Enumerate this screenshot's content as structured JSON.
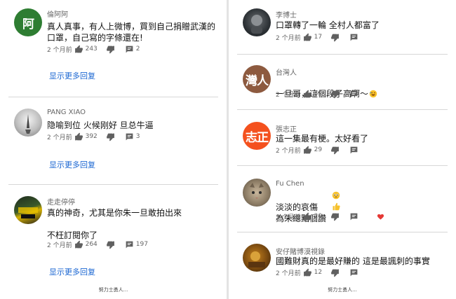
{
  "left": {
    "comments": [
      {
        "author": "倫阿阿",
        "avatar_text": "阿",
        "avatar_color": "#2e7d32",
        "body": "真人真事，有人上微博，買到自己捐贈武漢的\n口罩，自己寫的字條還在!",
        "time": "2 个月前",
        "likes": "243",
        "replies": "2"
      },
      {
        "author": "PANG XIAO",
        "avatar_text": "",
        "body": "隐喻到位 火候刚好 旦总牛逼",
        "time": "2 个月前",
        "likes": "392",
        "replies": "3"
      },
      {
        "author": "走走停停",
        "avatar_text": "",
        "body": "真的神奇，尤其是你朱一旦敢拍出來\n\n不枉訂閱你了",
        "time": "2 个月前",
        "likes": "264",
        "replies": "197"
      }
    ],
    "show_more": [
      "显示更多回复",
      "显示更多回复",
      "显示更多回复"
    ],
    "footer": "努力士勇人..."
  },
  "right": {
    "comments": [
      {
        "author": "李博士",
        "avatar_text": "",
        "body": "口罩轉了一輪 全村人都富了",
        "time": "2 个月前",
        "likes": "17",
        "replies": ""
      },
      {
        "author": "台灣人",
        "avatar_text": "灣人",
        "avatar_color": "#8d5a3f",
        "body": "一旦哥，這個段子高啊～",
        "time": "2 个月前",
        "likes": "32",
        "replies": ""
      },
      {
        "author": "張志正",
        "avatar_text": "志正",
        "avatar_color": "#f4511e",
        "body": "這一集最有梗。太好看了",
        "time": "2 个月前",
        "likes": "29",
        "replies": ""
      },
      {
        "author": "Fu Chen",
        "avatar_text": "",
        "body": "淡淡的哀傷\n為朱總點個讚",
        "time": "2 个月前",
        "likes": "20",
        "replies": ""
      },
      {
        "author": "安仔賭博漠視錄",
        "avatar_text": "",
        "body": "國難財真的是最好賺的 這是最諷刺的事實",
        "time": "2 个月前",
        "likes": "12",
        "replies": ""
      }
    ],
    "footer": "努力士勇人..."
  },
  "icons": {
    "like": "thumbs-up-icon",
    "dislike": "thumbs-down-icon",
    "reply": "comment-icon",
    "heart": "heart-icon",
    "emoji_laugh": "rofl-emoji-icon",
    "emoji_sad": "pleading-emoji-icon",
    "emoji_thumb": "thumbs-up-emoji-icon"
  },
  "colors": {
    "link": "#1a66d2",
    "heart": "#e53935"
  }
}
